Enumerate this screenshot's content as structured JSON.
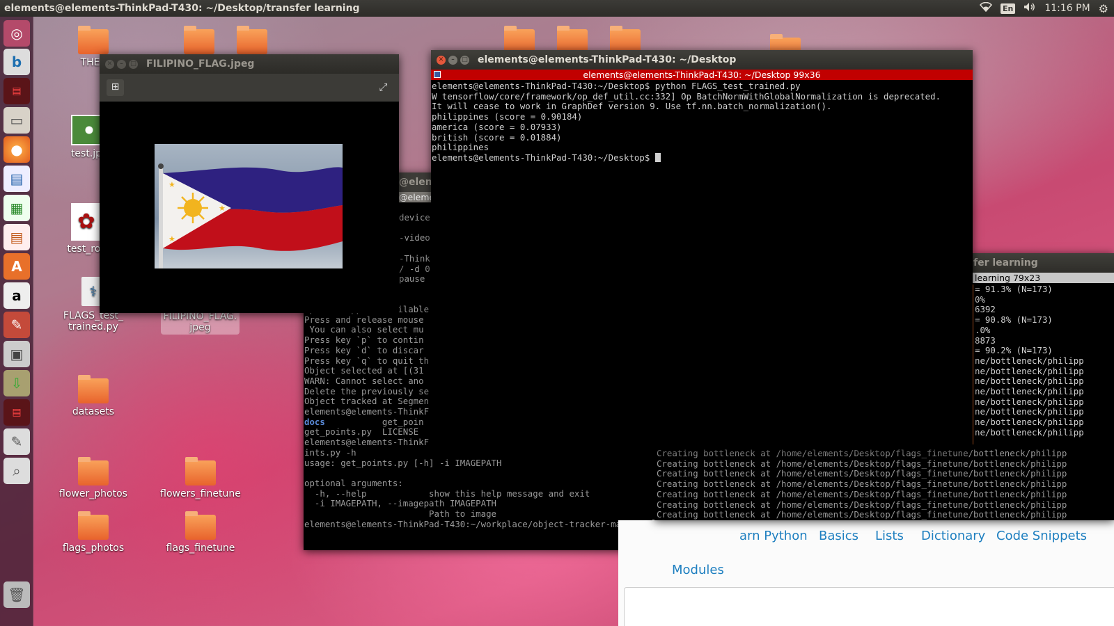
{
  "panel": {
    "title": "elements@elements-ThinkPad-T430: ~/Desktop/transfer learning",
    "lang": "En",
    "time": "11:16 PM"
  },
  "launcher_icons": [
    "ubuntu-dash-icon",
    "bing-icon",
    "terminal-icon",
    "files-icon",
    "firefox-icon",
    "writer-icon",
    "calc-icon",
    "impress-icon",
    "software-center-icon",
    "amazon-icon",
    "system-settings-icon",
    "printer-icon",
    "archive-icon",
    "terminal2-icon",
    "text-editor-icon",
    "screenshot-icon",
    "trash-icon"
  ],
  "desktop": {
    "icons": [
      {
        "label": "THES"
      },
      {
        "label": "test.jp"
      },
      {
        "label": "test_ros"
      },
      {
        "label": "FLAGS_test_\ntrained.py"
      },
      {
        "label": "FILIPINO_FLAG.\njpeg"
      },
      {
        "label": "datasets"
      },
      {
        "label": "flower_photos"
      },
      {
        "label": "flowers_finetune"
      },
      {
        "label": "flags_photos"
      },
      {
        "label": "flags_finetune"
      }
    ]
  },
  "viewer": {
    "title": "FILIPINO_FLAG.jpeg"
  },
  "main_terminal": {
    "title": "elements@elements-ThinkPad-T430: ~/Desktop",
    "tab": "elements@elements-ThinkPad-T430: ~/Desktop 99x36",
    "lines": [
      "elements@elements-ThinkPad-T430:~/Desktop$ python FLAGS_test_trained.py",
      "W tensorflow/core/framework/op_def_util.cc:332] Op BatchNormWithGlobalNormalization is deprecated.",
      "It will cease to work in GraphDef version 9. Use tf.nn.batch_normalization().",
      "philippines (score = 0.90184)",
      "america (score = 0.07933)",
      "british (score = 0.01884)",
      "philippines",
      "elements@elements-ThinkPad-T430:~/Desktop$ "
    ]
  },
  "back_terminal": {
    "partial_title": "@elem",
    "partial_tab": "@eleme",
    "lines_top": [
      "device",
      "",
      "-videoF",
      "",
      "-ThinkF",
      "/ -d 0",
      "pause "
    ],
    "lines": [
      "OpenGL support available",
      "Press and release mouse",
      " You can also select mu",
      "Press key `p` to contin",
      "Press key `d` to discar",
      "Press key `q` to quit th",
      "Object selected at [(31",
      "WARN: Cannot select ano",
      "Delete the previously se",
      "Object tracked at Segmen",
      "elements@elements-ThinkF",
      "docs           get_poin",
      "get_points.py  LICENSE",
      "elements@elements-ThinkF",
      "ints.py -h",
      "usage: get_points.py [-h] -i IMAGEPATH",
      "",
      "optional arguments:",
      "  -h, --help            show this help message and exit",
      "  -i IMAGEPATH, --imagepath IMAGEPATH",
      "                        Path to image",
      "elements@elements-ThinkPad-T430:~/workplace/object-tracker-master$ "
    ]
  },
  "right_terminal": {
    "partial_title": "fer learning",
    "partial_tab": "learning 79x23",
    "lines": [
      "= 91.3% (N=173)",
      "0%",
      "6392",
      "= 90.8% (N=173)",
      ".0%",
      "8873",
      "= 90.2% (N=173)",
      "ne/bottleneck/philipp",
      "ne/bottleneck/philipp",
      "ne/bottleneck/philipp",
      "ne/bottleneck/philipp",
      "ne/bottleneck/philipp",
      "ne/bottleneck/philipp",
      "ne/bottleneck/philipp",
      "ne/bottleneck/philipp"
    ],
    "bottom_lines": [
      "Creating bottleneck at /home/elements/Desktop/flags_finetune/bottleneck/philipp",
      "Creating bottleneck at /home/elements/Desktop/flags_finetune/bottleneck/philipp",
      "Creating bottleneck at /home/elements/Desktop/flags_finetune/bottleneck/philipp",
      "Creating bottleneck at /home/elements/Desktop/flags_finetune/bottleneck/philipp",
      "Creating bottleneck at /home/elements/Desktop/flags_finetune/bottleneck/philipp",
      "Creating bottleneck at /home/elements/Desktop/flags_finetune/bottleneck/philipp",
      "Creating bottleneck at /home/elements/Desktop/flags_finetune/bottleneck/philipp"
    ]
  },
  "browser": {
    "nav": [
      "arn Python",
      "Basics",
      "Lists",
      "Dictionary",
      "Code Snippets",
      "Modules"
    ]
  }
}
